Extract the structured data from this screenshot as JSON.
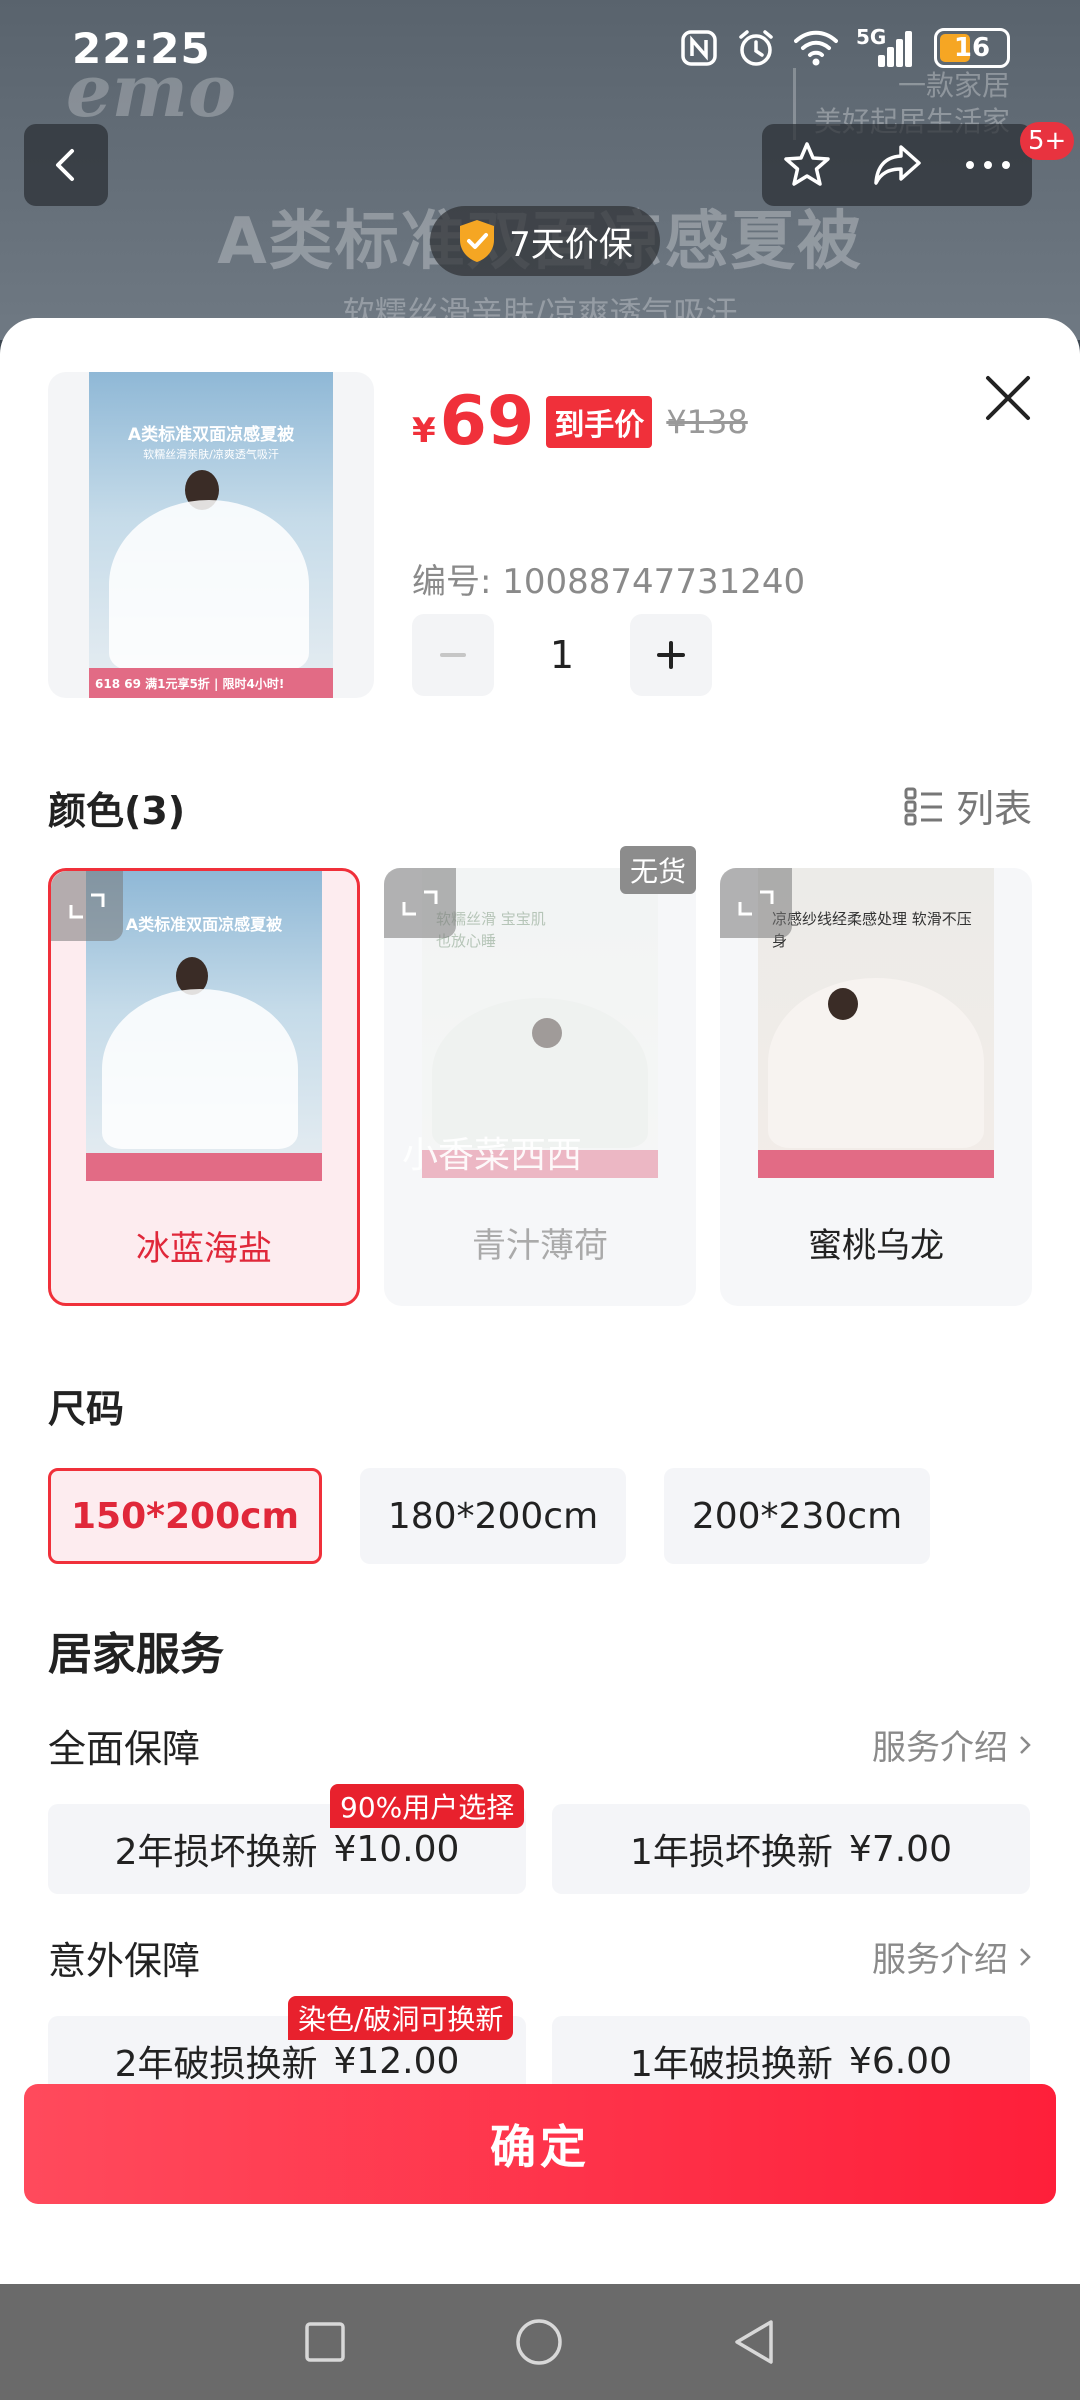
{
  "status_bar": {
    "time": "22:25",
    "network": "5G",
    "battery": "16",
    "icons": [
      "nfc-icon",
      "alarm-icon",
      "wifi-icon",
      "signal-icon",
      "battery-icon"
    ]
  },
  "background_page": {
    "brand": "emo",
    "brand_tagline_1": "一款家居",
    "brand_tagline_2": "美好起居生活家",
    "headline": "A类标准双面凉感夏被",
    "subline": "软糯丝滑亲肤/凉爽透气吸汗",
    "price_guarantee": "7天价保",
    "cart_badge": "5+"
  },
  "product": {
    "currency": "¥",
    "price": "69",
    "price_tag": "到手价",
    "original_price": "¥138",
    "sku_label": "编号: 10088747731240",
    "quantity": "1",
    "poster_title": "A类标准双面凉感夏被",
    "poster_subtitle": "软糯丝滑亲肤/凉爽透气吸汗",
    "poster_strip": "618  69  满1元享5折 | 限时4小时!"
  },
  "colors": {
    "title": "颜色(3)",
    "list_view_label": "列表",
    "items": [
      {
        "label": "冰蓝海盐",
        "selected": true,
        "poster_text": "A类标准双面凉感夏被"
      },
      {
        "label": "青汁薄荷",
        "disabled": true,
        "badge": "无货",
        "poster_text": "软糯丝滑 宝宝肌也放心睡"
      },
      {
        "label": "蜜桃乌龙",
        "poster_text": "凉感纱线经柔感处理 软滑不压身"
      }
    ],
    "watermark": "小香菜西西"
  },
  "sizes": {
    "title": "尺码",
    "options": [
      "150*200cm",
      "180*200cm",
      "200*230cm"
    ],
    "selected": "150*200cm"
  },
  "home_service": {
    "title": "居家服务",
    "groups": [
      {
        "title": "全面保障",
        "link": "服务介绍",
        "options": [
          {
            "name": "2年损坏换新",
            "price": "¥10.00",
            "tag": "90%用户选择"
          },
          {
            "name": "1年损坏换新",
            "price": "¥7.00"
          }
        ]
      },
      {
        "title": "意外保障",
        "link": "服务介绍",
        "options": [
          {
            "name": "2年破损换新",
            "price": "¥12.00",
            "tag": "染色/破洞可换新"
          },
          {
            "name": "1年破损换新",
            "price": "¥6.00"
          }
        ]
      }
    ]
  },
  "confirm_label": "确定",
  "colors_theme": {
    "accent": "#f0303a",
    "accent_light": "#fdecef"
  }
}
